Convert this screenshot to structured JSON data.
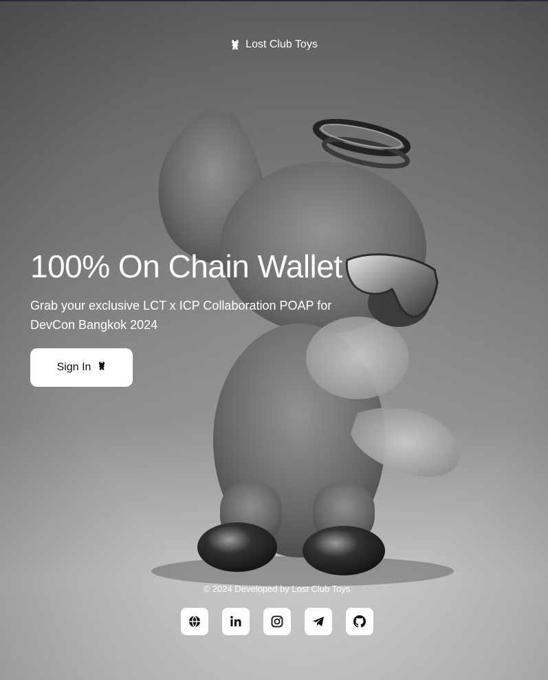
{
  "brand": {
    "name": "Lost Club Toys",
    "icon": "toy-icon"
  },
  "hero": {
    "title": "100% On Chain Wallet",
    "subtitle": "Grab your exclusive LCT x ICP Collaboration POAP for DevCon Bangkok 2024",
    "signin_label": "Sign In",
    "signin_icon": "toy-icon"
  },
  "footer": {
    "copyright": "© 2024 Developed by Lost Club Toys",
    "socials": [
      {
        "icon": "globe-icon"
      },
      {
        "icon": "linkedin-icon"
      },
      {
        "icon": "instagram-icon"
      },
      {
        "icon": "telegram-icon"
      },
      {
        "icon": "github-icon"
      }
    ]
  },
  "colors": {
    "text": "#ffffff",
    "button_bg": "#ffffff",
    "button_text": "#111111"
  }
}
